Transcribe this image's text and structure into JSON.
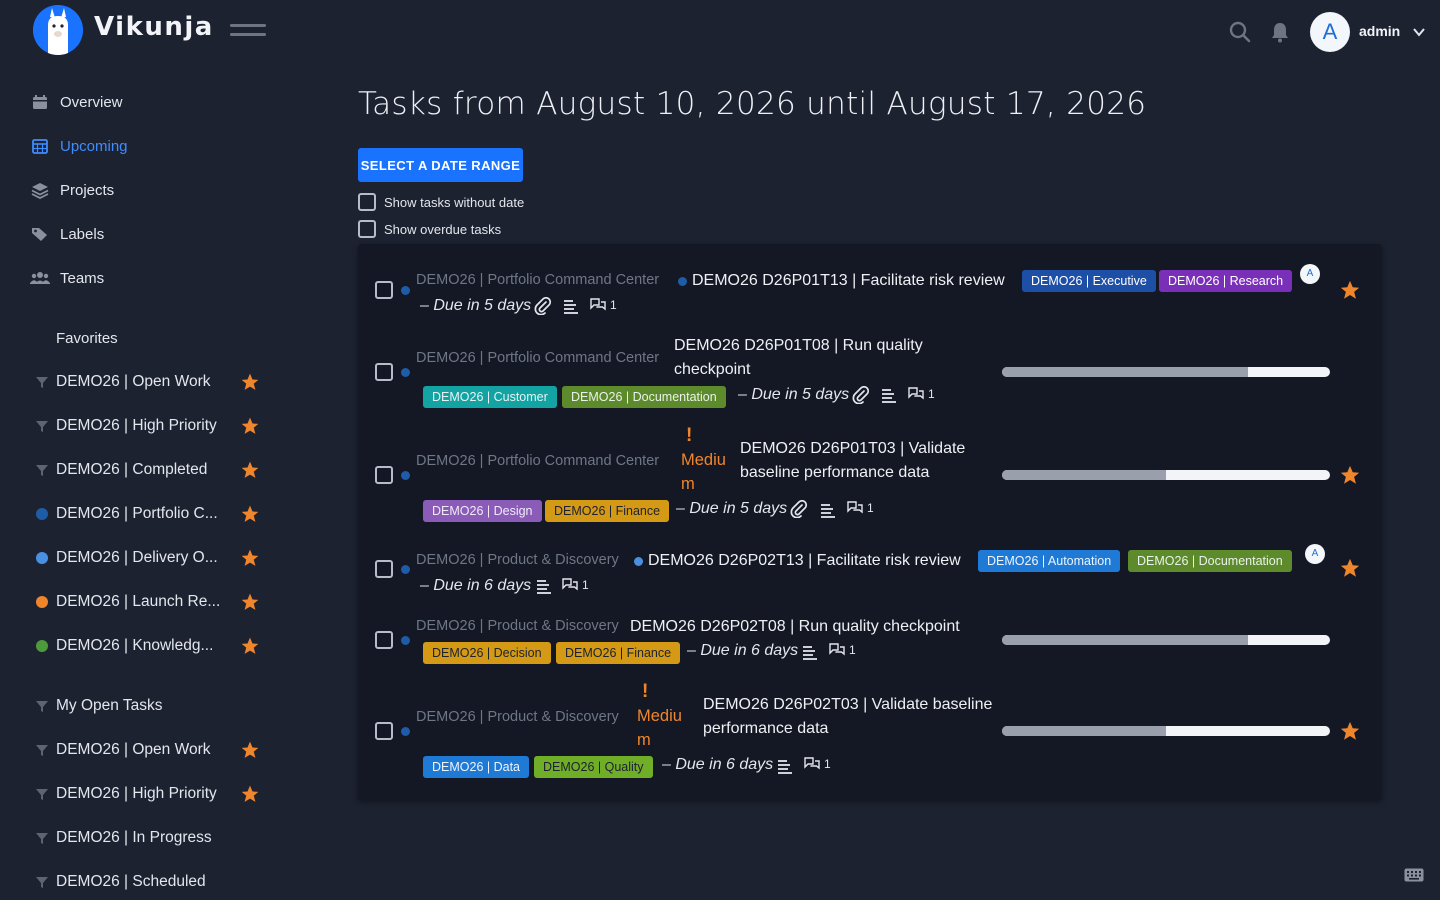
{
  "header": {
    "brand": "Vikunja",
    "username": "admin",
    "avatar_letter": "A"
  },
  "sidebar": {
    "nav": [
      {
        "label": "Overview",
        "icon": "calendar-icon"
      },
      {
        "label": "Upcoming",
        "icon": "calendar-grid-icon",
        "active": true
      },
      {
        "label": "Projects",
        "icon": "layers-icon"
      },
      {
        "label": "Labels",
        "icon": "tags-icon"
      },
      {
        "label": "Teams",
        "icon": "users-icon"
      }
    ],
    "favorites_heading": "Favorites",
    "favorites": [
      {
        "label": "DEMO26 | Open Work",
        "kind": "filter"
      },
      {
        "label": "DEMO26 | High Priority",
        "kind": "filter"
      },
      {
        "label": "DEMO26 | Completed",
        "kind": "filter"
      },
      {
        "label": "DEMO26 | Portfolio C...",
        "kind": "project",
        "color": "#1f5ca8"
      },
      {
        "label": "DEMO26 | Delivery O...",
        "kind": "project",
        "color": "#4a90e2"
      },
      {
        "label": "DEMO26 | Launch Re...",
        "kind": "project",
        "color": "#f0862c"
      },
      {
        "label": "DEMO26 | Knowledg...",
        "kind": "project",
        "color": "#4e9a3a"
      }
    ],
    "saved": [
      {
        "label": "My Open Tasks",
        "starred": false
      },
      {
        "label": "DEMO26 | Open Work",
        "starred": true
      },
      {
        "label": "DEMO26 | High Priority",
        "starred": true
      },
      {
        "label": "DEMO26 | In Progress",
        "starred": false
      },
      {
        "label": "DEMO26 | Scheduled",
        "starred": false
      }
    ]
  },
  "main": {
    "title": "Tasks from August 10, 2026 until August 17, 2026",
    "range_button": "SELECT A DATE RANGE",
    "show_without_date": "Show tasks without date",
    "show_overdue": "Show overdue tasks"
  },
  "tasks": [
    {
      "project": "DEMO26 | Portfolio Command Center",
      "title": "DEMO26 D26P01T13 | Facilitate risk review",
      "labels": [
        {
          "text": "DEMO26 | Executive",
          "bg": "#1e4fa6"
        },
        {
          "text": "DEMO26 | Research",
          "bg": "#7a2fb8"
        }
      ],
      "due": "– Due in 5 days",
      "comments": "1",
      "assignee": "A",
      "starred": true,
      "attachment": true
    },
    {
      "project": "DEMO26 | Portfolio Command Center",
      "title_line1": "DEMO26 D26P01T08 | Run quality",
      "title_line2": "checkpoint",
      "labels": [
        {
          "text": "DEMO26 | Customer",
          "bg": "#13a3a3"
        },
        {
          "text": "DEMO26 | Documentation",
          "bg": "#5d8a2b"
        }
      ],
      "due": "– Due in 5 days",
      "comments": "1",
      "progress": 0.75,
      "starred": false,
      "attachment": true
    },
    {
      "project": "DEMO26 | Portfolio Command Center",
      "priority_mark": "!",
      "priority": "Medium",
      "title_line1": "DEMO26 D26P01T03 | Validate",
      "title_line2": "baseline performance data",
      "labels": [
        {
          "text": "DEMO26 | Design",
          "bg": "#8a5cb8"
        },
        {
          "text": "DEMO26 | Finance",
          "bg": "#d49a15"
        }
      ],
      "due": "– Due in 5 days",
      "comments": "1",
      "progress": 0.5,
      "starred": true,
      "attachment": true
    },
    {
      "project": "DEMO26 | Product & Discovery",
      "title": "DEMO26 D26P02T13 | Facilitate risk review",
      "labels": [
        {
          "text": "DEMO26 | Automation",
          "bg": "#1f7ad6"
        },
        {
          "text": "DEMO26 | Documentation",
          "bg": "#5d8a2b"
        }
      ],
      "due": "– Due in 6 days",
      "comments": "1",
      "assignee": "A",
      "starred": true
    },
    {
      "project": "DEMO26 | Product & Discovery",
      "title": "DEMO26 D26P02T08 | Run quality checkpoint",
      "labels": [
        {
          "text": "DEMO26 | Decision",
          "bg": "#d49a15"
        },
        {
          "text": "DEMO26 | Finance",
          "bg": "#d49a15"
        }
      ],
      "due": "– Due in 6 days",
      "comments": "1",
      "progress": 0.75,
      "starred": false
    },
    {
      "project": "DEMO26 | Product & Discovery",
      "priority_mark": "!",
      "priority": "Medium",
      "title_line1": "DEMO26 D26P02T03 | Validate baseline",
      "title_line2": "performance data",
      "labels": [
        {
          "text": "DEMO26 | Data",
          "bg": "#1f7ad6"
        },
        {
          "text": "DEMO26 | Quality",
          "bg": "#6fae26"
        }
      ],
      "due": "– Due in 6 days",
      "comments": "1",
      "progress": 0.5,
      "starred": true
    }
  ],
  "colors": {
    "accent": "#1973ff",
    "star": "#f0862c",
    "background": "#1d2231",
    "card": "#131824"
  }
}
